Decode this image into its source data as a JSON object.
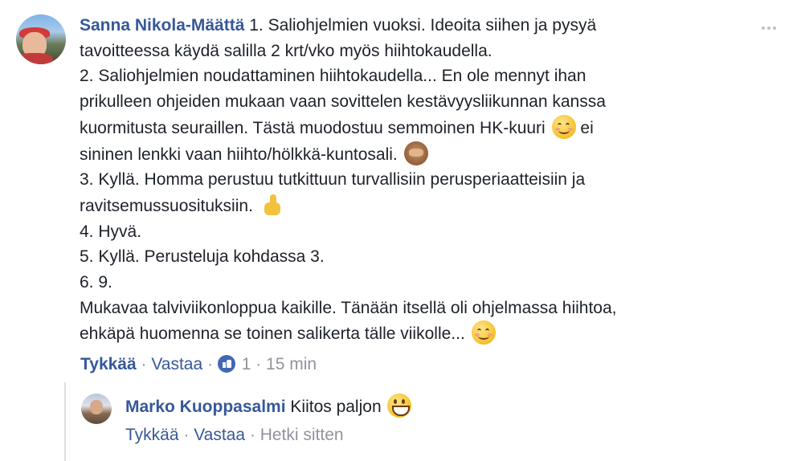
{
  "comment": {
    "author": "Sanna Nikola-Määttä",
    "lines": [
      "1. Saliohjelmien vuoksi. Ideoita siihen ja pysyä",
      "tavoitteessa käydä salilla 2 krt/vko myös hiihtokaudella.",
      "2. Saliohjelmien noudattaminen hiihtokaudella... En ole mennyt ihan",
      "prikulleen ohjeiden mukaan vaan sovittelen kestävyysliikunnan kanssa",
      "kuormitusta seuraillen. Tästä muodostuu semmoinen HK-kuuri",
      "ei",
      "sininen lenkki vaan hiihto/hölkkä-kuntosali.",
      "3. Kyllä. Homma perustuu tutkittuun turvallisiin perusperiaatteisiin ja",
      "ravitsemussuosituksiin.",
      "4. Hyvä.",
      "5. Kyllä. Perusteluja kohdassa 3.",
      "6. 9.",
      "Mukavaa talviviikonloppua kaikille. Tänään itsellä oli ohjelmassa hiihtoa,",
      "ehkäpä huomenna se toinen salikerta tälle viikolle..."
    ],
    "emojis": [
      "smiling-face-emoji",
      "see-no-evil-monkey-emoji",
      "thumbs-up-emoji",
      "smiling-face-emoji"
    ],
    "actions": {
      "like": "Tykkää",
      "sep1": " · ",
      "reply": "Vastaa",
      "sep2": " · ",
      "like_count": "1",
      "sep3": " · ",
      "time": "15 min"
    }
  },
  "reply": {
    "author": "Marko Kuoppasalmi",
    "text": "Kiitos paljon",
    "emoji": "grinning-face-emoji",
    "actions": {
      "like": "Tykkää",
      "sep1": " · ",
      "reply": "Vastaa",
      "sep2": " · ",
      "time": "Hetki sitten"
    }
  },
  "colors": {
    "name": "#365899",
    "meta": "#90949c",
    "text": "#1d2129",
    "like_badge": "#4267b2"
  }
}
